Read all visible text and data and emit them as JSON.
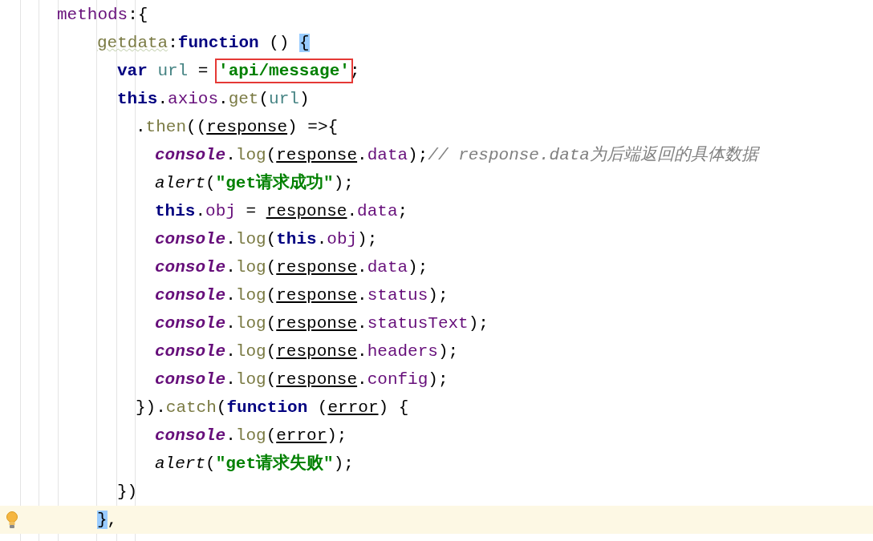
{
  "editor": {
    "lines": [
      {
        "current": false,
        "tokens": [
          {
            "text": "methods",
            "kind": "prop"
          },
          {
            "text": ":{",
            "kind": "plain"
          }
        ],
        "children": [
          {
            "current": false,
            "tokens": [
              {
                "text": "getdata",
                "kind": "funcname"
              },
              {
                "text": ":",
                "kind": "plain"
              },
              {
                "text": "function",
                "kind": "keyword"
              },
              {
                "text": " () ",
                "kind": "plain"
              },
              {
                "text": "{",
                "kind": "plain",
                "matched": true
              }
            ],
            "children": [
              {
                "current": false,
                "tokens": [
                  {
                    "text": "var",
                    "kind": "keyword"
                  },
                  {
                    "text": " url",
                    "kind": "local"
                  },
                  {
                    "text": " = ",
                    "kind": "plain"
                  },
                  {
                    "text": "'api/message'",
                    "kind": "string",
                    "boxed": true
                  },
                  {
                    "text": ";",
                    "kind": "plain"
                  }
                ]
              },
              {
                "current": false,
                "tokens": [
                  {
                    "text": "this",
                    "kind": "keyword"
                  },
                  {
                    "text": ".",
                    "kind": "plain"
                  },
                  {
                    "text": "axios",
                    "kind": "prop"
                  },
                  {
                    "text": ".",
                    "kind": "plain"
                  },
                  {
                    "text": "get",
                    "kind": "method"
                  },
                  {
                    "text": "(",
                    "kind": "plain"
                  },
                  {
                    "text": "url",
                    "kind": "local"
                  },
                  {
                    "text": ")",
                    "kind": "plain"
                  }
                ],
                "children": [
                  {
                    "current": false,
                    "tokens": [
                      {
                        "text": ".",
                        "kind": "plain"
                      },
                      {
                        "text": "then",
                        "kind": "method"
                      },
                      {
                        "text": "((",
                        "kind": "plain"
                      },
                      {
                        "text": "response",
                        "kind": "param"
                      },
                      {
                        "text": ") =>{",
                        "kind": "plain"
                      }
                    ],
                    "children": [
                      {
                        "current": false,
                        "tokens": [
                          {
                            "text": "console",
                            "kind": "global"
                          },
                          {
                            "text": ".",
                            "kind": "plain"
                          },
                          {
                            "text": "log",
                            "kind": "method"
                          },
                          {
                            "text": "(",
                            "kind": "plain"
                          },
                          {
                            "text": "response",
                            "kind": "param"
                          },
                          {
                            "text": ".",
                            "kind": "plain"
                          },
                          {
                            "text": "data",
                            "kind": "prop"
                          },
                          {
                            "text": ");",
                            "kind": "plain"
                          },
                          {
                            "text": "// response.data为后端返回的具体数据",
                            "kind": "comment"
                          }
                        ]
                      },
                      {
                        "current": false,
                        "tokens": [
                          {
                            "text": "alert",
                            "kind": "call"
                          },
                          {
                            "text": "(",
                            "kind": "plain"
                          },
                          {
                            "text": "\"get请求成功\"",
                            "kind": "string"
                          },
                          {
                            "text": ");",
                            "kind": "plain"
                          }
                        ]
                      },
                      {
                        "current": false,
                        "tokens": [
                          {
                            "text": "this",
                            "kind": "keyword"
                          },
                          {
                            "text": ".",
                            "kind": "plain"
                          },
                          {
                            "text": "obj",
                            "kind": "prop"
                          },
                          {
                            "text": " = ",
                            "kind": "plain"
                          },
                          {
                            "text": "response",
                            "kind": "param"
                          },
                          {
                            "text": ".",
                            "kind": "plain"
                          },
                          {
                            "text": "data",
                            "kind": "prop"
                          },
                          {
                            "text": ";",
                            "kind": "plain"
                          }
                        ]
                      },
                      {
                        "current": false,
                        "tokens": [
                          {
                            "text": "console",
                            "kind": "global"
                          },
                          {
                            "text": ".",
                            "kind": "plain"
                          },
                          {
                            "text": "log",
                            "kind": "method"
                          },
                          {
                            "text": "(",
                            "kind": "plain"
                          },
                          {
                            "text": "this",
                            "kind": "keyword"
                          },
                          {
                            "text": ".",
                            "kind": "plain"
                          },
                          {
                            "text": "obj",
                            "kind": "prop"
                          },
                          {
                            "text": ");",
                            "kind": "plain"
                          }
                        ]
                      },
                      {
                        "current": false,
                        "tokens": [
                          {
                            "text": "console",
                            "kind": "global"
                          },
                          {
                            "text": ".",
                            "kind": "plain"
                          },
                          {
                            "text": "log",
                            "kind": "method"
                          },
                          {
                            "text": "(",
                            "kind": "plain"
                          },
                          {
                            "text": "response",
                            "kind": "param"
                          },
                          {
                            "text": ".",
                            "kind": "plain"
                          },
                          {
                            "text": "data",
                            "kind": "prop"
                          },
                          {
                            "text": ");",
                            "kind": "plain"
                          }
                        ]
                      },
                      {
                        "current": false,
                        "tokens": [
                          {
                            "text": "console",
                            "kind": "global"
                          },
                          {
                            "text": ".",
                            "kind": "plain"
                          },
                          {
                            "text": "log",
                            "kind": "method"
                          },
                          {
                            "text": "(",
                            "kind": "plain"
                          },
                          {
                            "text": "response",
                            "kind": "param"
                          },
                          {
                            "text": ".",
                            "kind": "plain"
                          },
                          {
                            "text": "status",
                            "kind": "prop"
                          },
                          {
                            "text": ");",
                            "kind": "plain"
                          }
                        ]
                      },
                      {
                        "current": false,
                        "tokens": [
                          {
                            "text": "console",
                            "kind": "global"
                          },
                          {
                            "text": ".",
                            "kind": "plain"
                          },
                          {
                            "text": "log",
                            "kind": "method"
                          },
                          {
                            "text": "(",
                            "kind": "plain"
                          },
                          {
                            "text": "response",
                            "kind": "param"
                          },
                          {
                            "text": ".",
                            "kind": "plain"
                          },
                          {
                            "text": "statusText",
                            "kind": "prop"
                          },
                          {
                            "text": ");",
                            "kind": "plain"
                          }
                        ]
                      },
                      {
                        "current": false,
                        "tokens": [
                          {
                            "text": "console",
                            "kind": "global"
                          },
                          {
                            "text": ".",
                            "kind": "plain"
                          },
                          {
                            "text": "log",
                            "kind": "method"
                          },
                          {
                            "text": "(",
                            "kind": "plain"
                          },
                          {
                            "text": "response",
                            "kind": "param"
                          },
                          {
                            "text": ".",
                            "kind": "plain"
                          },
                          {
                            "text": "headers",
                            "kind": "prop"
                          },
                          {
                            "text": ");",
                            "kind": "plain"
                          }
                        ]
                      },
                      {
                        "current": false,
                        "tokens": [
                          {
                            "text": "console",
                            "kind": "global"
                          },
                          {
                            "text": ".",
                            "kind": "plain"
                          },
                          {
                            "text": "log",
                            "kind": "method"
                          },
                          {
                            "text": "(",
                            "kind": "plain"
                          },
                          {
                            "text": "response",
                            "kind": "param"
                          },
                          {
                            "text": ".",
                            "kind": "plain"
                          },
                          {
                            "text": "config",
                            "kind": "prop"
                          },
                          {
                            "text": ");",
                            "kind": "plain"
                          }
                        ]
                      }
                    ]
                  },
                  {
                    "current": false,
                    "tokens": [
                      {
                        "text": "}).",
                        "kind": "plain"
                      },
                      {
                        "text": "catch",
                        "kind": "method"
                      },
                      {
                        "text": "(",
                        "kind": "plain"
                      },
                      {
                        "text": "function",
                        "kind": "keyword"
                      },
                      {
                        "text": " (",
                        "kind": "plain"
                      },
                      {
                        "text": "error",
                        "kind": "param"
                      },
                      {
                        "text": ") {",
                        "kind": "plain"
                      }
                    ],
                    "children": [
                      {
                        "current": false,
                        "tokens": [
                          {
                            "text": "console",
                            "kind": "global"
                          },
                          {
                            "text": ".",
                            "kind": "plain"
                          },
                          {
                            "text": "log",
                            "kind": "method"
                          },
                          {
                            "text": "(",
                            "kind": "plain"
                          },
                          {
                            "text": "error",
                            "kind": "param"
                          },
                          {
                            "text": ");",
                            "kind": "plain"
                          }
                        ]
                      },
                      {
                        "current": false,
                        "tokens": [
                          {
                            "text": "alert",
                            "kind": "call"
                          },
                          {
                            "text": "(",
                            "kind": "plain"
                          },
                          {
                            "text": "\"get请求失败\"",
                            "kind": "string"
                          },
                          {
                            "text": ");",
                            "kind": "plain"
                          }
                        ]
                      }
                    ]
                  }
                ]
              },
              {
                "current": false,
                "tokens": [
                  {
                    "text": "})",
                    "kind": "plain"
                  }
                ]
              }
            ]
          },
          {
            "current": true,
            "bulb": true,
            "tokens": [
              {
                "text": "}",
                "kind": "plain",
                "matched": true
              },
              {
                "text": ",",
                "kind": "plain"
              }
            ]
          }
        ]
      }
    ]
  }
}
